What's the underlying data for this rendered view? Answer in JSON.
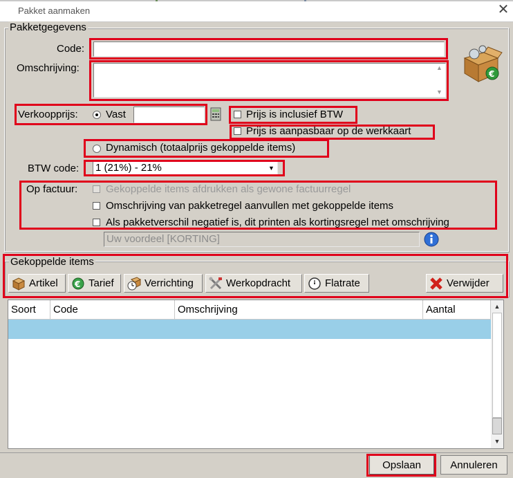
{
  "window": {
    "title": "Pakket aanmaken",
    "close_glyph": "✕"
  },
  "pakketgegevens": {
    "legend": "Pakketgegevens",
    "code_label": "Code:",
    "code_value": "",
    "omschrijving_label": "Omschrijving:",
    "omschrijving_value": "",
    "verkoopprijs_label": "Verkoopprijs:",
    "vast_label": "Vast",
    "vast_value": "",
    "prijs_incl_btw": "Prijs is inclusief BTW",
    "prijs_aanpasbaar": "Prijs is aanpasbaar op de werkkaart",
    "dynamisch_label": "Dynamisch (totaalprijs gekoppelde items)",
    "btw_label": "BTW code:",
    "btw_value": "1 (21%) - 21%",
    "op_factuur_label": "Op factuur:",
    "factuur_opt1": "Gekoppelde items afdrukken als gewone factuurregel",
    "factuur_opt2": "Omschrijving van pakketregel aanvullen met gekoppelde items",
    "factuur_opt3": "Als pakketverschil negatief is, dit printen als kortingsregel met omschrijving",
    "korting_text": "Uw voordeel [KORTING]"
  },
  "gekoppelde": {
    "legend": "Gekoppelde items",
    "buttons": [
      "Artikel",
      "Tarief",
      "Verrichting",
      "Werkopdracht",
      "Flatrate"
    ],
    "verwijder": "Verwijder"
  },
  "table": {
    "columns": [
      "Soort",
      "Code",
      "Omschrijving",
      "Aantal"
    ],
    "rows": []
  },
  "footer": {
    "opslaan": "Opslaan",
    "annuleren": "Annuleren"
  },
  "colors": {
    "highlight_red": "#e0001b",
    "row_selected": "#99cfe8",
    "dialog_bg": "#d4d0c8"
  }
}
